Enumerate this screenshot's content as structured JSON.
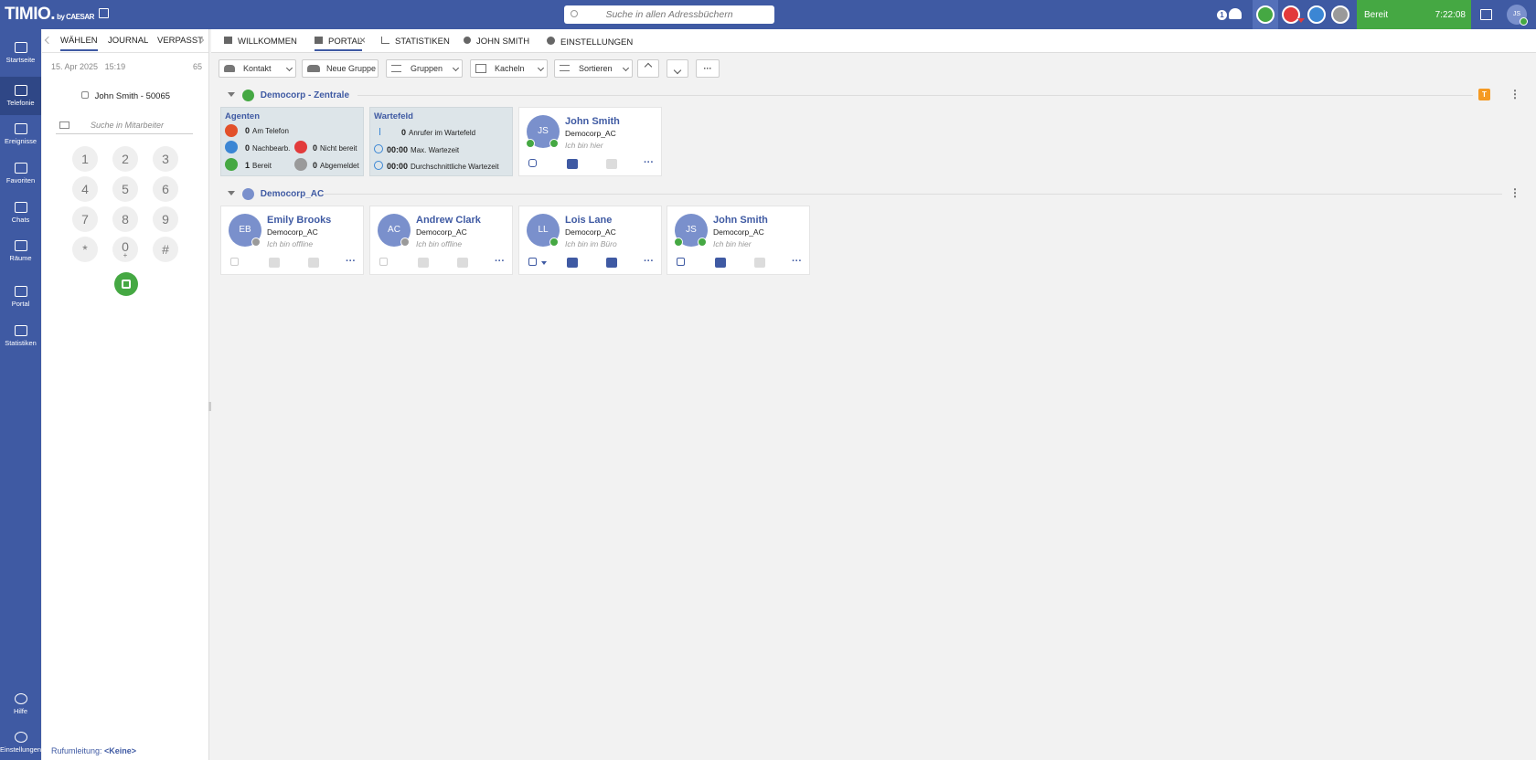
{
  "app": {
    "brand": "TIMIO.",
    "brand_sub": "by CAESAR"
  },
  "top": {
    "search_placeholder": "Suche in allen Adressbüchern",
    "badge": "1",
    "status": "Bereit",
    "time": "7:22:08",
    "user_initials": "JS"
  },
  "nav": [
    {
      "label": "Startseite",
      "icon": "home-icon"
    },
    {
      "label": "Telefonie",
      "icon": "phone-icon"
    },
    {
      "label": "Ereignisse",
      "icon": "calendar-icon"
    },
    {
      "label": "Favoriten",
      "icon": "star-icon"
    },
    {
      "label": "Chats",
      "icon": "chat-icon"
    },
    {
      "label": "Räume",
      "icon": "rooms-icon"
    },
    {
      "label": "Portal",
      "icon": "grid-icon"
    },
    {
      "label": "Statistiken",
      "icon": "chart-icon"
    }
  ],
  "nav_bottom": [
    {
      "label": "Hilfe",
      "icon": "help-icon"
    },
    {
      "label": "Einstellungen",
      "icon": "gear-icon"
    }
  ],
  "left": {
    "tabs": [
      "WÄHLEN",
      "JOURNAL",
      "VERPASST"
    ],
    "date": "15. Apr 2025",
    "clock": "15:19",
    "count": "65",
    "caller": "John Smith - 50065",
    "search_placeholder": "Suche in Mitarbeiter",
    "keys": [
      "1",
      "2",
      "3",
      "4",
      "5",
      "6",
      "7",
      "8",
      "9",
      "*",
      "0",
      "#"
    ],
    "key_sub": "+",
    "forward_label": "Rufumleitung:",
    "forward_value": "<Keine>"
  },
  "tabs": [
    "WILLKOMMEN",
    "PORTAL",
    "STATISTIKEN",
    "JOHN SMITH",
    "EINSTELLUNGEN"
  ],
  "toolbar": {
    "kontakt": "Kontakt",
    "neue_gruppe": "Neue Gruppe",
    "gruppen": "Gruppen",
    "kacheln": "Kacheln",
    "sortieren": "Sortieren",
    "more": "···"
  },
  "group1": {
    "name": "Democorp - Zentrale",
    "badge": "T"
  },
  "agenten": {
    "title": "Agenten",
    "am_telefon": "0",
    "am_telefon_label": "Am Telefon",
    "nachbearb": "0",
    "nachbearb_label": "Nachbearb.",
    "nicht_bereit": "0",
    "nicht_bereit_label": "Nicht bereit",
    "bereit": "1",
    "bereit_label": "Bereit",
    "abgemeldet": "0",
    "abgemeldet_label": "Abgemeldet"
  },
  "wartefeld": {
    "title": "Wartefeld",
    "anrufer": "0",
    "anrufer_label": "Anrufer im Wartefeld",
    "max": "00:00",
    "max_label": "Max. Wartezeit",
    "avg": "00:00",
    "avg_label": "Durchschnittliche Wartezeit"
  },
  "group1_contacts": [
    {
      "initials": "JS",
      "name": "John Smith",
      "org": "Democorp_AC",
      "status": "Ich bin hier"
    }
  ],
  "group2": {
    "name": "Democorp_AC"
  },
  "group2_contacts": [
    {
      "initials": "EB",
      "name": "Emily Brooks",
      "org": "Democorp_AC",
      "status": "Ich bin offline"
    },
    {
      "initials": "AC",
      "name": "Andrew Clark",
      "org": "Democorp_AC",
      "status": "Ich bin offline"
    },
    {
      "initials": "LL",
      "name": "Lois Lane",
      "org": "Democorp_AC",
      "status": "Ich bin im Büro"
    },
    {
      "initials": "JS",
      "name": "John Smith",
      "org": "Democorp_AC",
      "status": "Ich bin hier"
    }
  ]
}
